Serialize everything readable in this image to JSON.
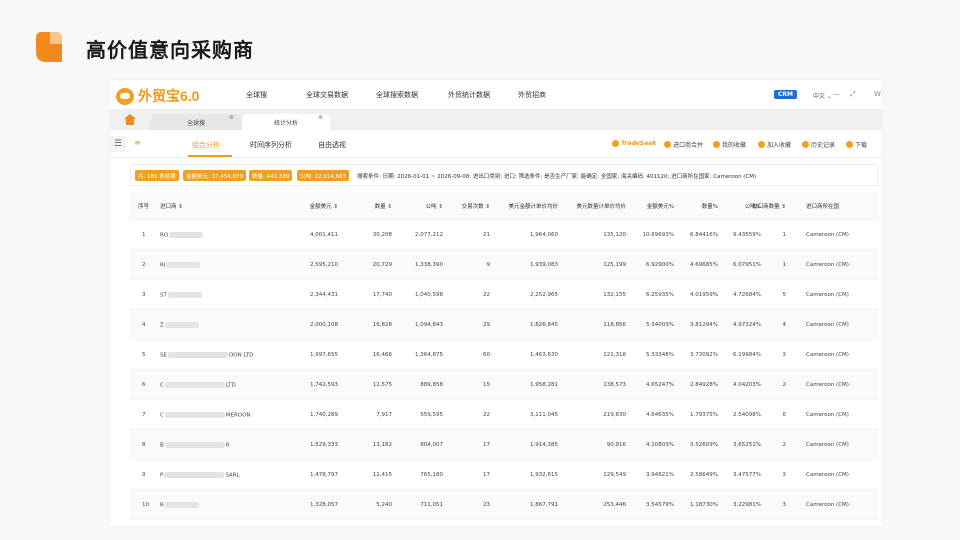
{
  "slide": {
    "title": "高价值意向采购商"
  },
  "nav": {
    "brand": "外贸宝6.0",
    "items": [
      "全球搜",
      "全球交易数据",
      "全球搜索数据",
      "外贸统计数据",
      "外贸招商"
    ],
    "crm": "CRM",
    "lang": "中文 ⌄",
    "extra": "W"
  },
  "tabs": [
    {
      "label": "全球搜"
    },
    {
      "label": "统计分析"
    }
  ],
  "subtabs": [
    "组合分析",
    "时间序列分析",
    "自由透视"
  ],
  "actions": [
    "TradeSeek",
    "进口商合并",
    "我的收藏",
    "加入收藏",
    "历史记录",
    "下载"
  ],
  "stats": {
    "badges": [
      "共: 181 条结果",
      "金额美元: 37,454,879",
      "数量: 441,339",
      "公吨: 22,014,663"
    ],
    "conditions": "搜索条件:  日期: 2026-01-01 ~ 2026-09-08; 进出口类别: 进口; 筛选条件: 是否生产厂家: 能确定: 全国家; 海关编码: 401120; 进口商所在国家: Cameroon (CM)"
  },
  "table": {
    "headers": [
      "序号",
      "进口商 ⇕",
      "金额美元 ⇕",
      "数量 ⇕",
      "公吨 ⇕",
      "交易次数 ⇕",
      "美元金额计单价均价",
      "美元数量计单价均价",
      "金额美元%",
      "数量%",
      "公吨%",
      "出口商数量 ⇕",
      "进口商所在国"
    ],
    "rows": [
      [
        "1",
        "RO",
        "",
        "4,001,411",
        "30,208",
        "2,077,212",
        "21",
        "1,964,060",
        "135,120",
        "10.69693%",
        "6.84416%",
        "9.43559%",
        "1",
        "Cameroon (CM)"
      ],
      [
        "2",
        "RI",
        "",
        "2,595,210",
        "20,729",
        "1,338,390",
        "9",
        "1,939,083",
        "125,199",
        "6.92900%",
        "4.69685%",
        "6.07951%",
        "1",
        "Cameroon (CM)"
      ],
      [
        "3",
        "ST",
        "",
        "2,344,431",
        "17,740",
        "1,040,598",
        "22",
        "2,252,965",
        "132,155",
        "6.25935%",
        "4.01959%",
        "4.72684%",
        "5",
        "Cameroon (CM)"
      ],
      [
        "4",
        "Z",
        "",
        "2,000,108",
        "16,828",
        "1,094,843",
        "29",
        "1,826,845",
        "118,856",
        "5.34003%",
        "3.81294%",
        "4.97324%",
        "4",
        "Cameroon (CM)"
      ],
      [
        "5",
        "SE",
        "OON LTD",
        "1,997,655",
        "16,466",
        "1,364,875",
        "60",
        "1,463,630",
        "121,318",
        "5.33348%",
        "3.73092%",
        "6.19984%",
        "3",
        "Cameroon (CM)"
      ],
      [
        "6",
        "C",
        "LTD",
        "1,742,593",
        "12,575",
        "889,858",
        "15",
        "1,958,281",
        "138,573",
        "4.65247%",
        "2.84928%",
        "4.04203%",
        "2",
        "Cameroon (CM)"
      ],
      [
        "7",
        "C",
        "MEROON",
        "1,740,289",
        "7,917",
        "559,595",
        "22",
        "3,111,045",
        "219,830",
        "4.64635%",
        "1.79375%",
        "2.54098%",
        "6",
        "Cameroon (CM)"
      ],
      [
        "8",
        "B",
        "R",
        "1,529,333",
        "13,182",
        "804,007",
        "17",
        "1,914,385",
        "90,916",
        "4.10803%",
        "3.52609%",
        "3.65251%",
        "2",
        "Cameroon (CM)"
      ],
      [
        "9",
        "P",
        "SARL",
        "1,478,797",
        "11,415",
        "765,180",
        "17",
        "1,932,615",
        "129,549",
        "3.94821%",
        "2.58649%",
        "3.47577%",
        "3",
        "Cameroon (CM)"
      ],
      [
        "10",
        "R",
        "",
        "1,328,057",
        "5,240",
        "711,051",
        "23",
        "1,867,791",
        "253,446",
        "3.54579%",
        "1.18730%",
        "3.22981%",
        "3",
        "Cameroon (CM)"
      ]
    ]
  },
  "colors": {
    "accent": "#ef9a1a",
    "crm": "#1a6ed8"
  }
}
